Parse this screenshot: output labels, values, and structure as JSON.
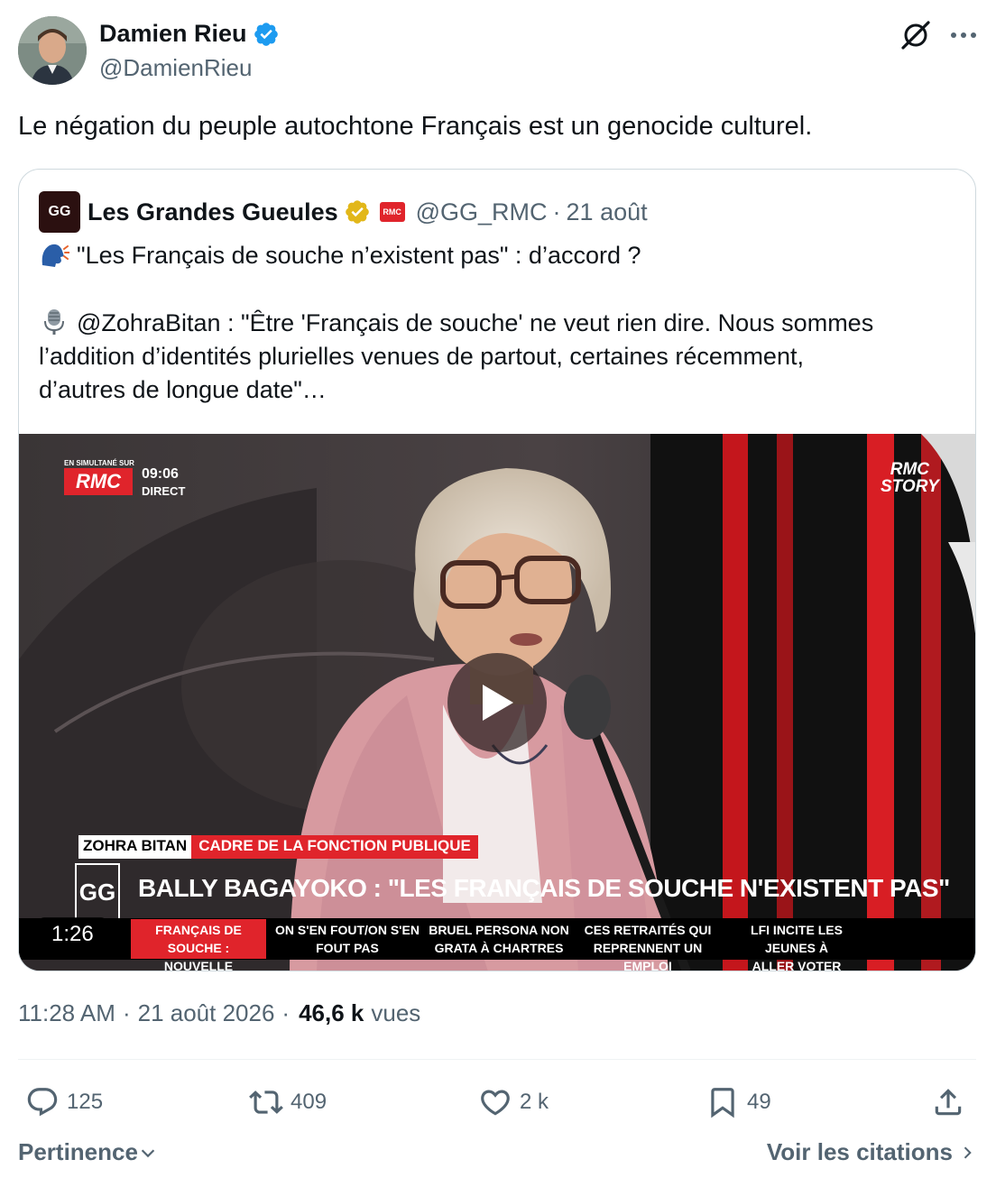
{
  "author": {
    "display_name": "Damien Rieu",
    "handle": "@DamienRieu",
    "verified_color": "#1d9bf0"
  },
  "tweet": {
    "text": "Le négation du peuple autochtone Français est un genocide culturel."
  },
  "quote": {
    "display_name": "Les Grandes Gueules",
    "affiliate_badge": "RMC",
    "handle": "@GG_RMC",
    "separator": "·",
    "date": "21 août",
    "line1": "\"Les Français de souche n’existent pas\" : d’accord ?",
    "line2": "@ZohraBitan : \"Être 'Français de souche' ne veut rien dire. Nous sommes",
    "line3": "l’addition d’identités plurielles venues de partout, certaines récemment,",
    "line4": "d’autres de longue date\"…",
    "avatar_text": "GG"
  },
  "video": {
    "duration": "1:26",
    "overlay": {
      "simulcast_label": "EN SIMULTANÉ SUR",
      "channel_logo": "RMC",
      "clock": "09:06",
      "live_label": "DIRECT",
      "corner_logo_line1": "RMC",
      "corner_logo_line2": "STORY",
      "speaker_name": "ZOHRA BITAN",
      "speaker_role": "CADRE DE LA FONCTION PUBLIQUE",
      "headline": "BALLY BAGAYOKO : \"LES FRANÇAIS DE SOUCHE N'EXISTENT PAS\"",
      "show_logo": "GG",
      "ticker_main_1": "FRANÇAIS DE SOUCHE :",
      "ticker_main_2": "NOUVELLE POLÉMIQUE",
      "ticker": [
        {
          "l1": "ON S'EN FOUT/ON S'EN",
          "l2": "FOUT PAS"
        },
        {
          "l1": "BRUEL PERSONA NON",
          "l2": "GRATA À CHARTRES"
        },
        {
          "l1": "CES RETRAITÉS QUI",
          "l2": "REPRENNENT UN EMPLOI"
        },
        {
          "l1": "LFI INCITE LES JEUNES À",
          "l2": "ALLER VOTER"
        }
      ]
    }
  },
  "meta": {
    "time": "11:28 AM",
    "separator": "·",
    "date": "21 août 2026",
    "views_count": "46,6 k",
    "views_label": "vues"
  },
  "actions": {
    "replies": "125",
    "reposts": "409",
    "likes": "2 k",
    "bookmarks": "49"
  },
  "footer": {
    "sort_label": "Pertinence",
    "quotes_link": "Voir les citations"
  }
}
